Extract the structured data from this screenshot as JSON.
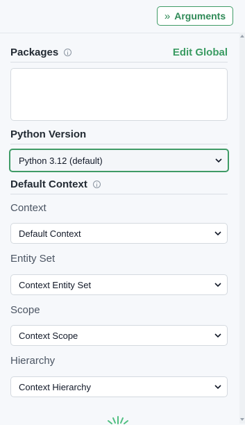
{
  "header": {
    "arguments_label": "Arguments"
  },
  "packages": {
    "title": "Packages",
    "edit_label": "Edit Global"
  },
  "python_version": {
    "title": "Python Version",
    "selected": "Python 3.12 (default)"
  },
  "default_context": {
    "title": "Default Context",
    "fields": [
      {
        "label": "Context",
        "value": "Default Context"
      },
      {
        "label": "Entity Set",
        "value": "Context Entity Set"
      },
      {
        "label": "Scope",
        "value": "Context Scope"
      },
      {
        "label": "Hierarchy",
        "value": "Context Hierarchy"
      }
    ]
  },
  "colors": {
    "accent": "#3f9b66",
    "background": "#f6f8fb"
  },
  "icons": [
    "chevrons-right-icon",
    "info-icon",
    "chevron-down-icon",
    "loading-spinner-icon"
  ]
}
